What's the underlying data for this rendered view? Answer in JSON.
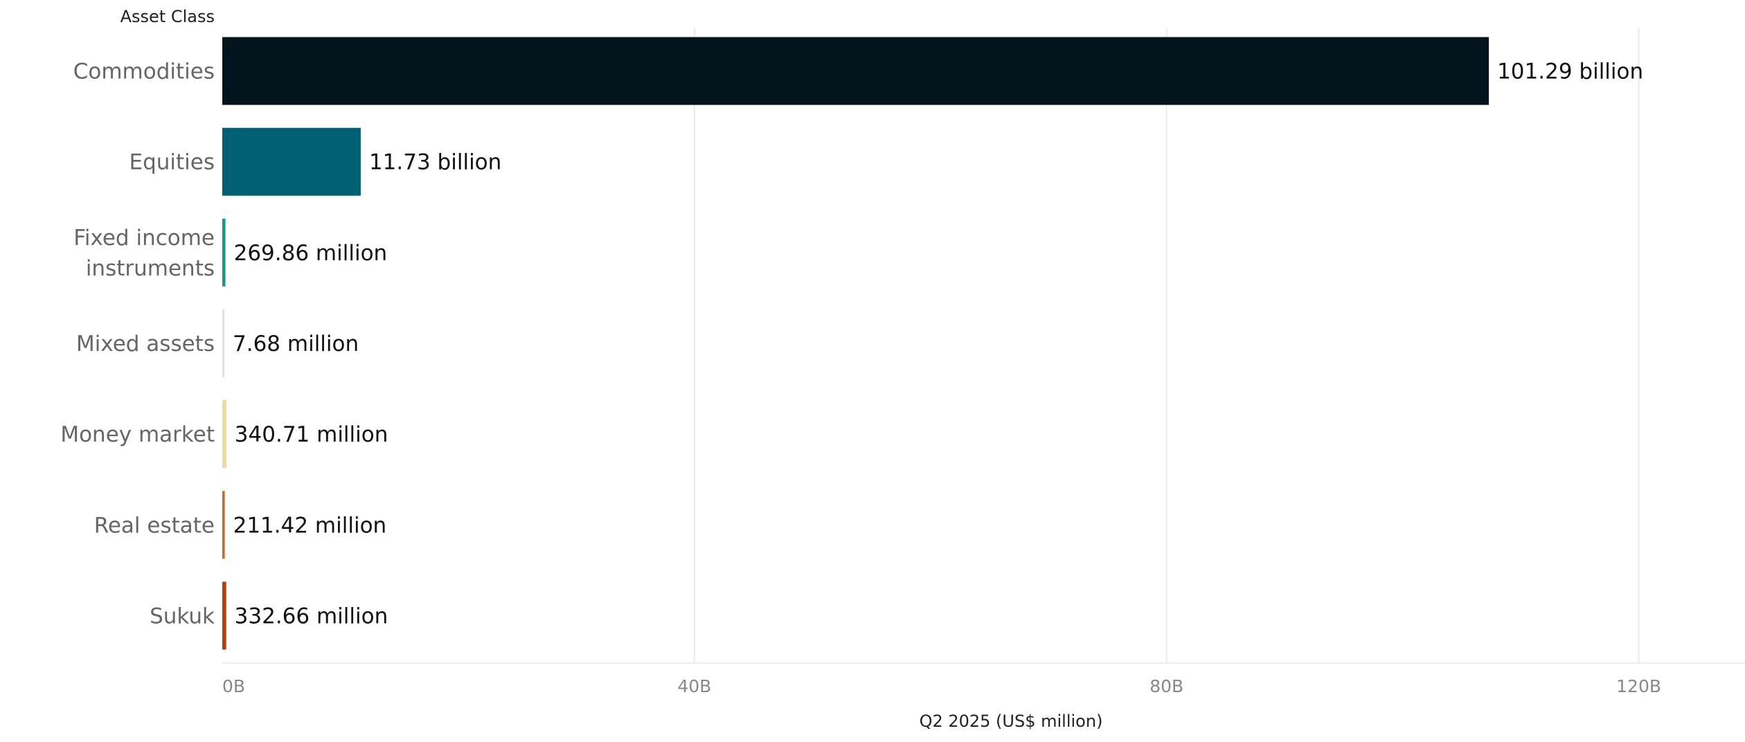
{
  "chart_data": {
    "type": "bar",
    "orientation": "horizontal",
    "category_header": "Asset Class",
    "xlabel": "Q2 2025 (US$ million)",
    "categories": [
      "Commodities",
      "Equities",
      "Fixed income instruments",
      "Mixed assets",
      "Money market",
      "Real estate",
      "Sukuk"
    ],
    "category_lines": [
      [
        "Commodities"
      ],
      [
        "Equities"
      ],
      [
        "Fixed income",
        "instruments"
      ],
      [
        "Mixed assets"
      ],
      [
        "Money market"
      ],
      [
        "Real estate"
      ],
      [
        "Sukuk"
      ]
    ],
    "values": [
      107300000000,
      11730000000,
      269860000,
      7680000,
      340710000,
      211420000,
      332660000
    ],
    "value_labels": [
      "101.29 billion",
      "11.73 billion",
      "269.86 million",
      "7.68 million",
      "340.71 million",
      "211.42 million",
      "332.66 million"
    ],
    "colors": [
      "#03141c",
      "#015f74",
      "#169a8e",
      "#cfe8e3",
      "#efd9a0",
      "#c76d2a",
      "#b5400f"
    ],
    "xlim": [
      0,
      129000000000
    ],
    "ticks": [
      0,
      40000000000,
      80000000000,
      120000000000
    ],
    "tick_labels": [
      "0B",
      "40B",
      "80B",
      "120B"
    ],
    "grid": true,
    "legend": "none"
  }
}
